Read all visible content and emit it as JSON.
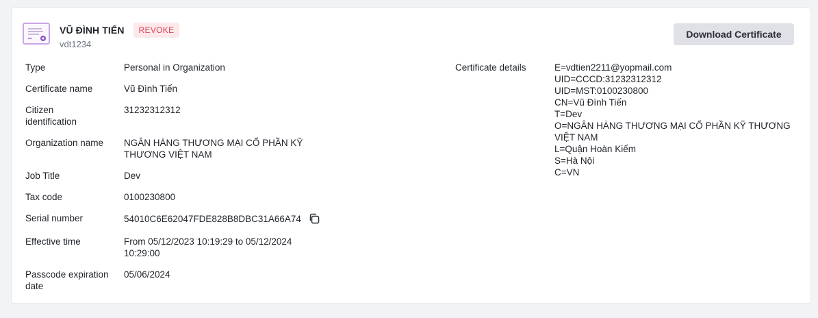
{
  "header": {
    "name": "VŨ ĐÌNH TIẾN",
    "status": "REVOKE",
    "username": "vdt1234",
    "download_label": "Download Certificate",
    "icon": "certificate-icon"
  },
  "fields": [
    {
      "label": "Type",
      "value": "Personal in Organization"
    },
    {
      "label": "Certificate name",
      "value": "Vũ Đình Tiến"
    },
    {
      "label": "Citizen identification",
      "value": "31232312312"
    },
    {
      "label": "Organization name",
      "value": "NGÂN HÀNG THƯƠNG MẠI CỔ PHẦN KỸ THƯƠNG VIỆT NAM"
    },
    {
      "label": "Job Title",
      "value": "Dev"
    },
    {
      "label": "Tax code",
      "value": "0100230800"
    },
    {
      "label": "Serial number",
      "value": "54010C6E62047FDE828B8DBC31A66A74"
    },
    {
      "label": "Effective time",
      "value": "From 05/12/2023 10:19:29 to 05/12/2024 10:29:00"
    },
    {
      "label": "Passcode expiration date",
      "value": "05/06/2024"
    }
  ],
  "certificate_details": {
    "label": "Certificate details",
    "lines": [
      "E=vdtien2211@yopmail.com",
      "UID=CCCD:31232312312",
      "UID=MST:0100230800",
      "CN=Vũ Đình Tiến",
      "T=Dev",
      "O=NGÂN HÀNG THƯƠNG MẠI CỔ PHẦN KỸ THƯƠNG VIỆT NAM",
      "L=Quận Hoàn Kiếm",
      "S=Hà Nội",
      "C=VN"
    ]
  },
  "colors": {
    "status_bg": "#fde8ea",
    "status_text": "#e0435b",
    "button_bg": "#dfe1e6",
    "icon_accent": "#8e4ec6"
  }
}
